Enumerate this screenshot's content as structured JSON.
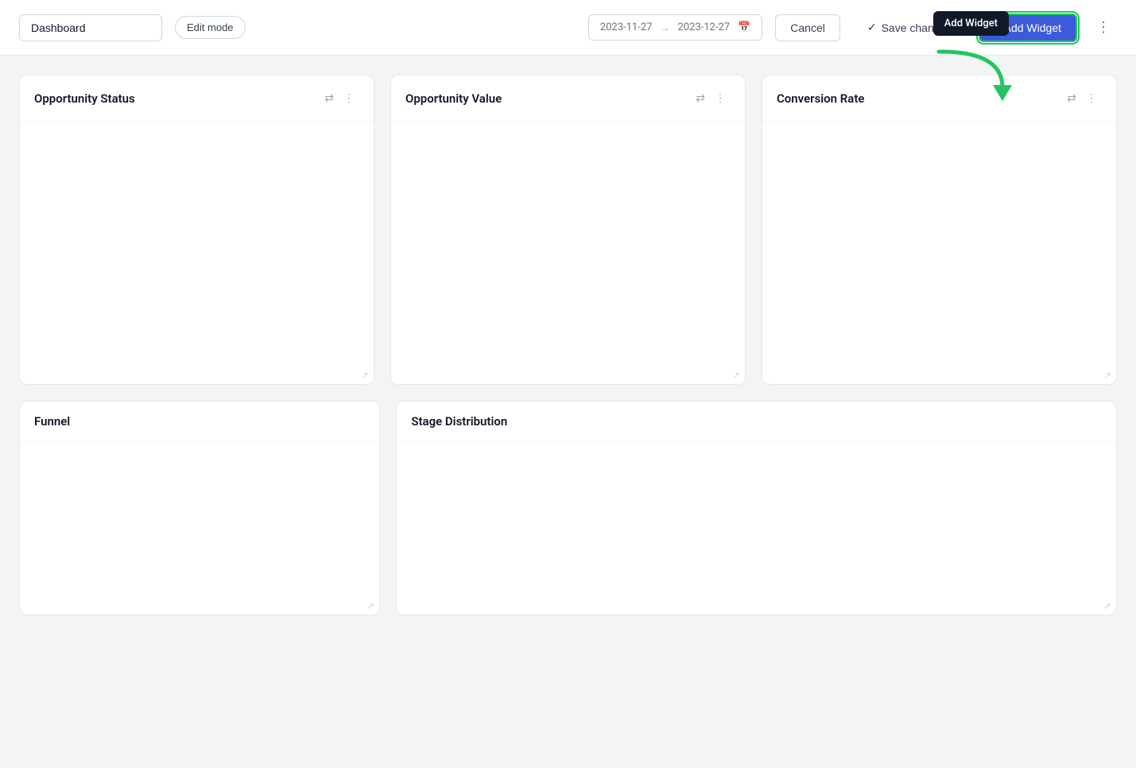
{
  "topbar": {
    "dashboard_label": "Dashboard",
    "edit_mode_label": "Edit mode",
    "date_start": "2023-11-27",
    "date_end": "2023-12-27",
    "cancel_label": "Cancel",
    "save_changes_label": "Save changes",
    "add_widget_label": "+ Add Widget",
    "tooltip_label": "Add Widget"
  },
  "widgets": {
    "row1": [
      {
        "title": "Opportunity Status"
      },
      {
        "title": "Opportunity Value"
      },
      {
        "title": "Conversion Rate"
      }
    ],
    "row2": [
      {
        "title": "Funnel"
      },
      {
        "title": "Stage Distribution"
      }
    ]
  }
}
